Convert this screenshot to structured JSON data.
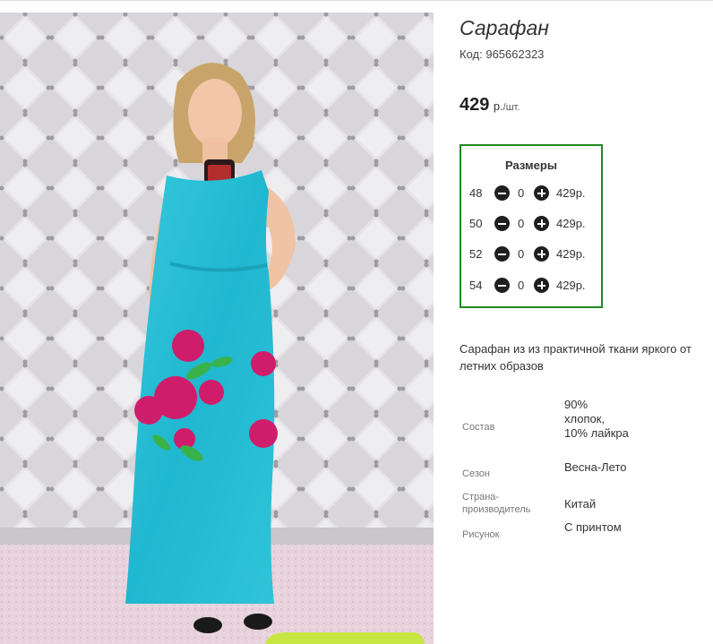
{
  "product": {
    "title": "Сарафан",
    "code_label": "Код:",
    "code_value": "965662323",
    "price_value": "429",
    "price_unit": "р.",
    "price_per": "/шт."
  },
  "sizes": {
    "title": "Размеры",
    "rows": [
      {
        "size": "48",
        "qty": "0",
        "price": "429р."
      },
      {
        "size": "50",
        "qty": "0",
        "price": "429р."
      },
      {
        "size": "52",
        "qty": "0",
        "price": "429р."
      },
      {
        "size": "54",
        "qty": "0",
        "price": "429р."
      }
    ]
  },
  "description": "Сарафан из из практичной ткани яркого от летних образов",
  "properties": [
    {
      "label": "Состав",
      "value": "90% хлопок, 10% лайкра"
    },
    {
      "label": "Сезон",
      "value": "Весна-Лето"
    },
    {
      "label": "Страна-производитель",
      "value": "Китай"
    },
    {
      "label": "Рисунок",
      "value": "С принтом"
    }
  ]
}
